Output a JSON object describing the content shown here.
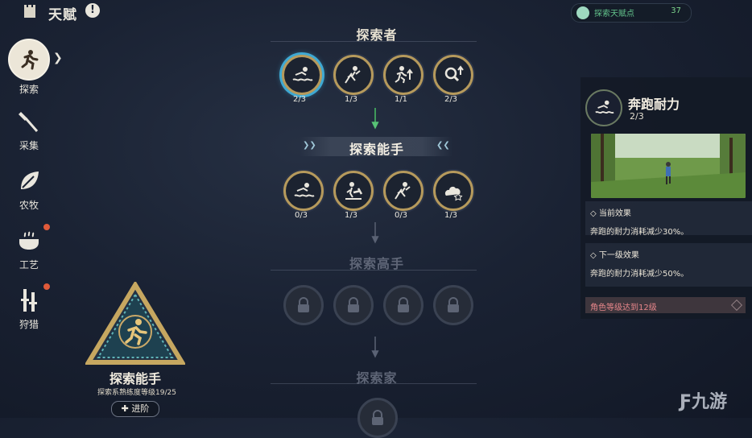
{
  "header": {
    "title": "天赋",
    "help_icon": "exclamation-icon"
  },
  "points": {
    "label": "探索天赋点",
    "value": "37"
  },
  "sidebar": {
    "items": [
      {
        "label": "探索",
        "icon": "runner-icon",
        "active": true
      },
      {
        "label": "采集",
        "icon": "axe-icon"
      },
      {
        "label": "农牧",
        "icon": "leaf-icon"
      },
      {
        "label": "工艺",
        "icon": "cooking-pot-icon",
        "notify": true
      },
      {
        "label": "狩猎",
        "icon": "hunting-tools-icon",
        "notify": true
      }
    ]
  },
  "tree": {
    "tier1": {
      "title": "探索者",
      "nodes": [
        {
          "count": "2/3",
          "icon": "swim-icon",
          "selected": true
        },
        {
          "count": "1/3",
          "icon": "climb-icon"
        },
        {
          "count": "1/1",
          "icon": "sprint-up-icon"
        },
        {
          "count": "2/3",
          "icon": "search-up-icon"
        }
      ]
    },
    "tier2": {
      "title": "探索能手",
      "nodes": [
        {
          "count": "0/3",
          "icon": "swim-icon"
        },
        {
          "count": "1/3",
          "icon": "pickaxe-icon"
        },
        {
          "count": "0/3",
          "icon": "climb-icon"
        },
        {
          "count": "1/3",
          "icon": "bush-star-icon"
        }
      ]
    },
    "tier3": {
      "title": "探索高手"
    },
    "tier4": {
      "title": "探索家"
    }
  },
  "badge": {
    "title": "探索能手",
    "subtitle": "探索系熟练度等级19/25",
    "advance": "进阶"
  },
  "detail": {
    "title": "奔跑耐力",
    "level": "2/3",
    "current_head": "当前效果",
    "current_text": "奔跑的耐力消耗减少30%。",
    "next_head": "下一级效果",
    "next_text": "奔跑的耐力消耗减少50%。",
    "requirement": "角色等级达到12级"
  },
  "watermark": "九游",
  "colors": {
    "gold": "#b69a5c",
    "accent_blue": "#3fa9d3",
    "green": "#63c48c",
    "req_red": "#e6868a"
  }
}
